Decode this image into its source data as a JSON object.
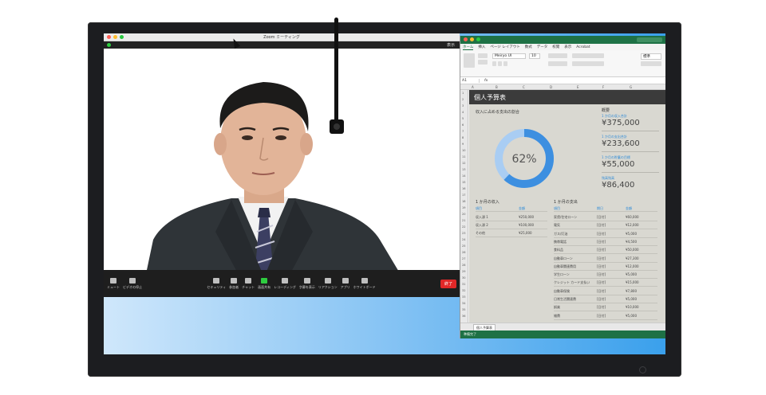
{
  "zoom": {
    "window_title": "Zoom ミーティング",
    "view_label": "表示",
    "toolbar": [
      {
        "label": "ミュート",
        "icon": "mic-icon"
      },
      {
        "label": "ビデオの停止",
        "icon": "video-icon"
      },
      {
        "label": "セキュリティ",
        "icon": "shield-icon"
      },
      {
        "label": "参加者",
        "icon": "participants-icon"
      },
      {
        "label": "チャット",
        "icon": "chat-icon"
      },
      {
        "label": "画面共有",
        "icon": "share-screen-icon"
      },
      {
        "label": "レコーディング",
        "icon": "record-icon"
      },
      {
        "label": "字幕を表示",
        "icon": "captions-icon"
      },
      {
        "label": "リアクション",
        "icon": "reaction-icon"
      },
      {
        "label": "アプリ",
        "icon": "apps-icon"
      },
      {
        "label": "ホワイトボード",
        "icon": "whiteboard-icon"
      }
    ],
    "end_button": "終了"
  },
  "excel": {
    "ribbon_tabs": [
      "ホーム",
      "挿入",
      "ページ レイアウト",
      "数式",
      "データ",
      "校閲",
      "表示",
      "Acrobat"
    ],
    "font_name": "Meiryo UI",
    "font_size": "10",
    "number_format": "標準",
    "cell_ref": "A1",
    "formula_fx": "fx",
    "columns": [
      "A",
      "B",
      "C",
      "D",
      "E",
      "F",
      "G"
    ],
    "rows": [
      "1",
      "2",
      "3",
      "4",
      "5",
      "6",
      "7",
      "8",
      "9",
      "10",
      "11",
      "12",
      "13",
      "14",
      "15",
      "16",
      "17",
      "18",
      "19",
      "20",
      "21",
      "22",
      "23",
      "24",
      "25",
      "26",
      "27",
      "28",
      "29",
      "30",
      "31",
      "32",
      "33",
      "34",
      "35",
      "36"
    ],
    "sheet_tab": "個人予算表",
    "status_text": "準備完了",
    "sheet": {
      "banner": "個人予算表",
      "chart_title": "収入に占める支出の割合",
      "donut_percent": "62%",
      "donut_fraction": 0.62,
      "summary_title": "概要",
      "kpis": [
        {
          "label": "1 か月の収入合計",
          "value": "¥375,000"
        },
        {
          "label": "1 か月の支出合計",
          "value": "¥233,600"
        },
        {
          "label": "1 か月の貯蓄の目標",
          "value": "¥55,000"
        },
        {
          "label": "残高残高",
          "value": "¥86,400"
        }
      ],
      "income": {
        "title": "1 か月の収入",
        "headers": [
          "項目",
          "金額"
        ],
        "rows": [
          [
            "収入源 1",
            "¥250,000"
          ],
          [
            "収入源 2",
            "¥100,000"
          ],
          [
            "その他",
            "¥25,000"
          ]
        ]
      },
      "expenses": {
        "title": "1 か月の支出",
        "headers": [
          "項目",
          "期日",
          "金額"
        ],
        "rows": [
          [
            "家賃/住宅ローン",
            "[日付]",
            "¥60,000"
          ],
          [
            "電気",
            "[日付]",
            "¥12,000"
          ],
          [
            "ガス/灯油",
            "[日付]",
            "¥5,000"
          ],
          [
            "携帯電話",
            "[日付]",
            "¥4,500"
          ],
          [
            "食料品",
            "[日付]",
            "¥50,000"
          ],
          [
            "自動車ローン",
            "[日付]",
            "¥27,300"
          ],
          [
            "自動車関連費用",
            "[日付]",
            "¥12,000"
          ],
          [
            "学生ローン",
            "[日付]",
            "¥5,000"
          ],
          [
            "クレジット カード支払い",
            "[日付]",
            "¥15,000"
          ],
          [
            "自動車保険",
            "[日付]",
            "¥7,800"
          ],
          [
            "日常生活関連費",
            "[日付]",
            "¥5,000"
          ],
          [
            "娯楽",
            "[日付]",
            "¥10,000"
          ],
          [
            "雑費",
            "[日付]",
            "¥5,000"
          ]
        ]
      }
    }
  },
  "colors": {
    "excel_green": "#1e7145",
    "accent_blue": "#2e8bd8",
    "donut_fill": "#3d8fe0",
    "donut_track": "#a9cdf3",
    "end_red": "#e02828"
  }
}
